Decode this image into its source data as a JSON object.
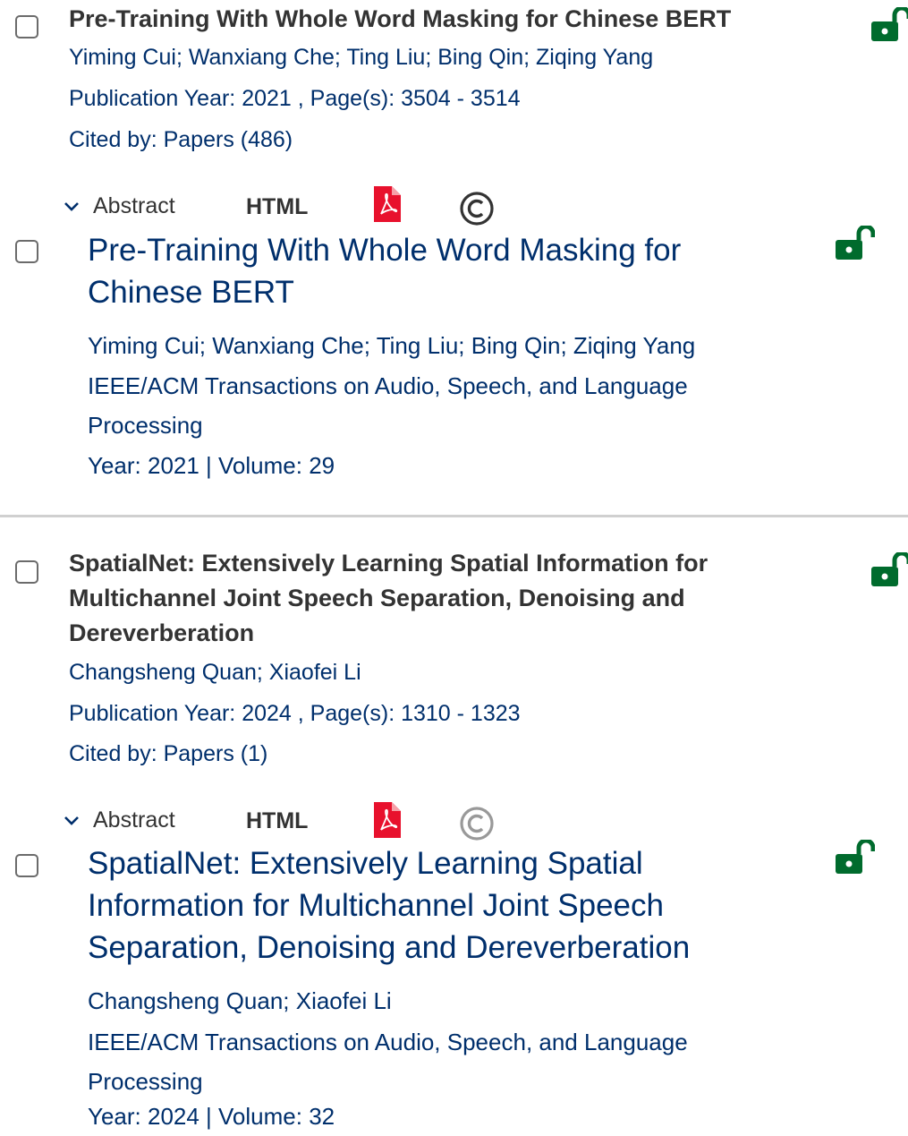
{
  "colors": {
    "text_dark": "#333333",
    "text_blue": "#002f6c",
    "lock_green": "#006b2d",
    "pdf_red": "#e8112d",
    "divider": "#d0d0d0",
    "checkbox_border": "#6b6b6b"
  },
  "icons": {
    "checkbox": "checkbox-icon",
    "lock": "open-lock-icon",
    "chevron": "chevron-down-icon",
    "pdf": "pdf-icon",
    "rights": "copyright-icon"
  },
  "results": [
    {
      "compact": {
        "title": "Pre-Training With Whole Word Masking for Chinese BERT",
        "authors": "Yiming Cui; Wanxiang Che; Ting Liu; Bing Qin; Ziqing Yang",
        "pub_line": "Publication Year: 2021 , Page(s): 3504  -  3514",
        "cited_line": "Cited by: Papers (486)"
      },
      "actions": {
        "abstract_label": "Abstract",
        "html_label": "HTML"
      },
      "expanded": {
        "title_line1": "Pre-Training With Whole Word Masking for",
        "title_line2": "Chinese BERT",
        "authors": "Yiming Cui; Wanxiang Che; Ting Liu; Bing Qin; Ziqing Yang",
        "journal_line1": "IEEE/ACM Transactions on Audio, Speech, and Language",
        "journal_line2": "Processing",
        "year_volume": "Year: 2021  | Volume: 29"
      }
    },
    {
      "compact": {
        "title_line1": "SpatialNet: Extensively Learning Spatial Information for",
        "title_line2": "Multichannel Joint Speech Separation, Denoising and",
        "title_line3": "Dereverberation",
        "authors": "Changsheng Quan; Xiaofei Li",
        "pub_line": "Publication Year: 2024 , Page(s): 1310  -  1323",
        "cited_line": "Cited by: Papers (1)"
      },
      "actions": {
        "abstract_label": "Abstract",
        "html_label": "HTML"
      },
      "expanded": {
        "title_line1": "SpatialNet: Extensively Learning Spatial",
        "title_line2": "Information for Multichannel Joint Speech",
        "title_line3": "Separation, Denoising and Dereverberation",
        "authors": "Changsheng Quan; Xiaofei Li",
        "journal_line1": "IEEE/ACM Transactions on Audio, Speech, and Language",
        "journal_line2": "Processing",
        "year_volume": "Year: 2024  | Volume: 32"
      }
    }
  ]
}
